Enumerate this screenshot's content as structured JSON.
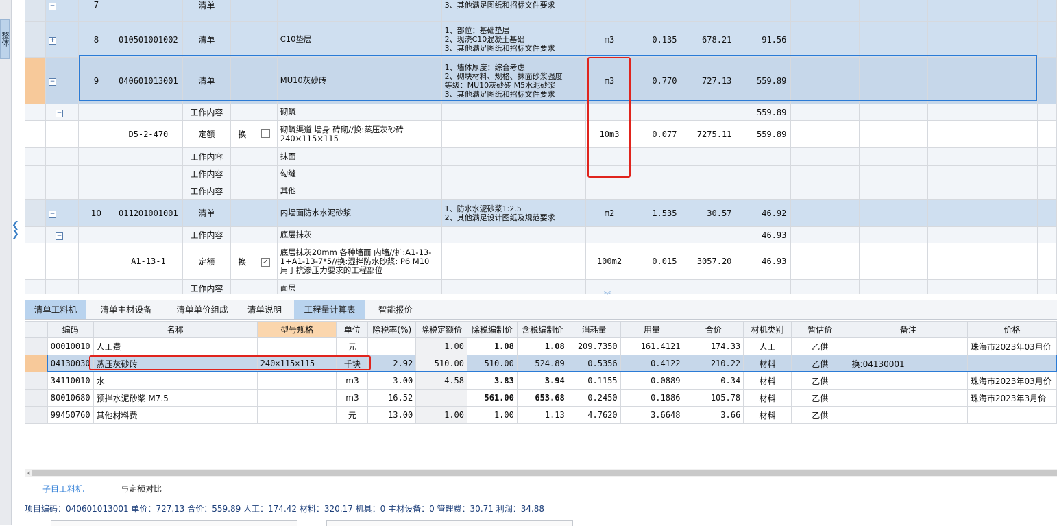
{
  "side_tab_label": "整体",
  "upper": {
    "rows": [
      {
        "kind": "item",
        "seq": "7",
        "code": "",
        "type": "清单",
        "name": "",
        "features": "3、其他满足图纸和招标文件要求",
        "unit": "",
        "qty": "",
        "price": "",
        "total": ""
      },
      {
        "kind": "item",
        "seq": "8",
        "code": "010501001002",
        "type": "清单",
        "name": "C10垫层",
        "features": "1、部位：基础垫层\n2、现浇C10混凝土基础\n3、其他满足图纸和招标文件要求",
        "unit": "m3",
        "qty": "0.135",
        "price": "678.21",
        "total": "91.56"
      },
      {
        "kind": "sel",
        "seq": "9",
        "code": "040601013001",
        "type": "清单",
        "name": "MU10灰砂砖",
        "features": "1、墙体厚度：综合考虑\n2、砌块材料、规格、抹面砂浆强度\n等级：MU10灰砂砖 M5水泥砂浆\n3、其他满足图纸和招标文件要求",
        "unit": "m3",
        "qty": "0.770",
        "price": "727.13",
        "total": "559.89"
      },
      {
        "kind": "sub",
        "seq": "",
        "code": "",
        "type": "工作内容",
        "name": "砌筑",
        "features": "",
        "unit": "",
        "qty": "",
        "price": "",
        "total": "559.89"
      },
      {
        "kind": "quota",
        "seq": "",
        "code": "D5-2-470",
        "type": "定额",
        "swap": "换",
        "name": "砌筑渠道 墙身 砖砌//换:蒸压灰砂砖 240×115×115",
        "features": "",
        "unit": "10m3",
        "qty": "0.077",
        "price": "7275.11",
        "total": "559.89"
      },
      {
        "kind": "sub",
        "seq": "",
        "code": "",
        "type": "工作内容",
        "name": "抹面",
        "features": "",
        "unit": "",
        "qty": "",
        "price": "",
        "total": ""
      },
      {
        "kind": "sub",
        "seq": "",
        "code": "",
        "type": "工作内容",
        "name": "勾缝",
        "features": "",
        "unit": "",
        "qty": "",
        "price": "",
        "total": ""
      },
      {
        "kind": "sub",
        "seq": "",
        "code": "",
        "type": "工作内容",
        "name": "其他",
        "features": "",
        "unit": "",
        "qty": "",
        "price": "",
        "total": ""
      },
      {
        "kind": "item",
        "seq": "10",
        "code": "011201001001",
        "type": "清单",
        "name": "内墙面防水水泥砂浆",
        "features": "1、防水水泥砂浆1:2.5\n2、其他满足设计图纸及规范要求",
        "unit": "m2",
        "qty": "1.535",
        "price": "30.57",
        "total": "46.92"
      },
      {
        "kind": "sub",
        "seq": "",
        "code": "",
        "type": "工作内容",
        "name": "底层抹灰",
        "features": "",
        "unit": "",
        "qty": "",
        "price": "",
        "total": "46.93"
      },
      {
        "kind": "quota",
        "seq": "",
        "code": "A1-13-1",
        "type": "定额",
        "swap": "换",
        "name": "底层抹灰20mm 各种墙面 内墙//扩:A1-13-1+A1-13-7*5//换:湿拌防水砂浆: P6 M10 用于抗渗压力要求的工程部位",
        "features": "",
        "unit": "100m2",
        "qty": "0.015",
        "price": "3057.20",
        "total": "46.93"
      },
      {
        "kind": "sub",
        "seq": "",
        "code": "",
        "type": "工作内容",
        "name": "面层",
        "features": "",
        "unit": "",
        "qty": "",
        "price": "",
        "total": ""
      }
    ]
  },
  "tabs": [
    "清单工料机",
    "清单主材设备",
    "清单单价组成",
    "清单说明",
    "工程量计算表",
    "智能报价"
  ],
  "lower": {
    "headers": [
      "编码",
      "名称",
      "型号规格",
      "单位",
      "除税率(%)",
      "除税定额价",
      "除税编制价",
      "含税编制价",
      "消耗量",
      "用量",
      "合价",
      "材机类别",
      "暂估价",
      "备注",
      "价格"
    ],
    "rows": [
      {
        "code": "00010010",
        "name": "人工费",
        "spec": "",
        "unit": "元",
        "tax": "",
        "qprice": "1.00",
        "nprice": "1.08",
        "tprice": "1.08",
        "consume": "209.7350",
        "usage": "161.4121",
        "total": "174.33",
        "cat": "人工",
        "est": "乙供",
        "note": "",
        "src": "珠海市2023年03月价"
      },
      {
        "code": "04130030",
        "name": "蒸压灰砂砖",
        "spec": "240×115×115",
        "unit": "千块",
        "tax": "2.92",
        "qprice": "510.00",
        "nprice": "510.00",
        "tprice": "524.89",
        "consume": "0.5356",
        "usage": "0.4122",
        "total": "210.22",
        "cat": "材料",
        "est": "乙供",
        "note": "换:04130001",
        "src": ""
      },
      {
        "code": "34110010",
        "name": "水",
        "spec": "",
        "unit": "m3",
        "tax": "3.00",
        "qprice": "4.58",
        "nprice": "3.83",
        "tprice": "3.94",
        "consume": "0.1155",
        "usage": "0.0889",
        "total": "0.34",
        "cat": "材料",
        "est": "乙供",
        "note": "",
        "src": "珠海市2023年03月价"
      },
      {
        "code": "80010680",
        "name": "预拌水泥砂浆 M7.5",
        "spec": "",
        "unit": "m3",
        "tax": "16.52",
        "qprice": "",
        "nprice": "561.00",
        "tprice": "653.68",
        "consume": "0.2450",
        "usage": "0.1886",
        "total": "105.78",
        "cat": "材料",
        "est": "乙供",
        "note": "",
        "src": "珠海市2023年3月价"
      },
      {
        "code": "99450760",
        "name": "其他材料费",
        "spec": "",
        "unit": "元",
        "tax": "13.00",
        "qprice": "1.00",
        "nprice": "1.00",
        "tprice": "1.13",
        "consume": "4.7620",
        "usage": "3.6648",
        "total": "3.66",
        "cat": "材料",
        "est": "乙供",
        "note": "",
        "src": ""
      }
    ]
  },
  "bottom_tabs": [
    "子目工料机",
    "与定额对比"
  ],
  "status": {
    "text": "项目编码：040601013001  单价：727.13  合价：559.89  人工：174.42  材料：320.17  机具：0  主材设备：0  管理费：30.71  利润：34.88"
  },
  "colors": {
    "accent": "#2b7bd6",
    "highlight_box": "#e0241d",
    "selected_gutter": "#f7c99a",
    "item_row": "#cfdff0",
    "active_tab": "#b9d3ee"
  }
}
